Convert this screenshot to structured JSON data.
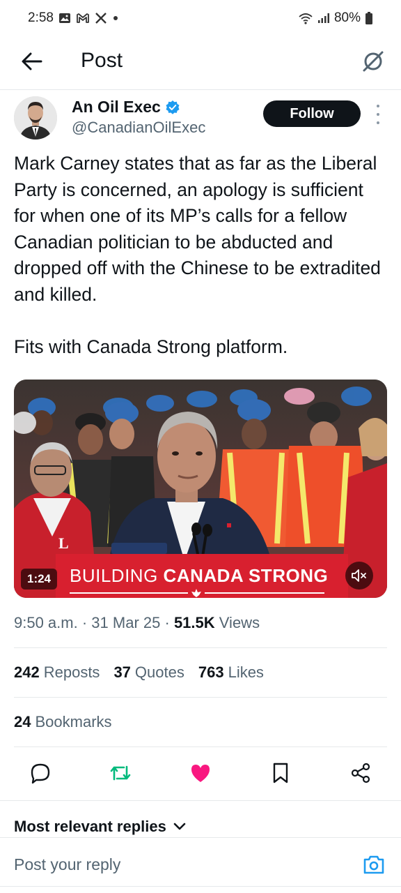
{
  "status_bar": {
    "time": "2:58",
    "battery": "80%",
    "notification_icons": [
      "gallery-icon",
      "gmail-icon",
      "x-icon",
      "dot-icon"
    ],
    "system_icons": [
      "wifi-icon",
      "signal-icon",
      "battery-icon"
    ]
  },
  "header": {
    "title": "Post",
    "back_icon": "arrow-left-icon",
    "grok_icon": "grok-icon"
  },
  "post": {
    "author_name": "An Oil Exec",
    "author_handle": "@CanadianOilExec",
    "verified": true,
    "follow_label": "Follow",
    "text_paragraphs": [
      "Mark Carney states that as far as the Liberal Party is concerned, an apology is sufficient for when one of its MP’s calls for a fellow Canadian politician to be abducted and dropped off with the Chinese to be extradited and killed.",
      "Fits with Canada Strong platform."
    ],
    "media": {
      "duration": "1:24",
      "banner_text_light": "BUILDING",
      "banner_text_bold": "CANADA STRONG",
      "podium_logo": "L",
      "muted": true
    },
    "time": "9:50 a.m.",
    "date": "31 Mar 25",
    "views_count": "51.5K",
    "views_label": "Views",
    "reposts_count": "242",
    "reposts_label": "Reposts",
    "quotes_count": "37",
    "quotes_label": "Quotes",
    "likes_count": "763",
    "likes_label": "Likes",
    "bookmarks_count": "24",
    "bookmarks_label": "Bookmarks"
  },
  "actions": [
    "reply-icon",
    "repost-icon",
    "like-icon",
    "bookmark-icon",
    "share-icon"
  ],
  "colors": {
    "repost_green": "#00ba7c",
    "like_pink": "#f91880",
    "verified_blue": "#1d9bf0",
    "banner_red": "#d8202f"
  },
  "replies": {
    "sort_label": "Most relevant replies",
    "placeholder": "Post your reply"
  }
}
